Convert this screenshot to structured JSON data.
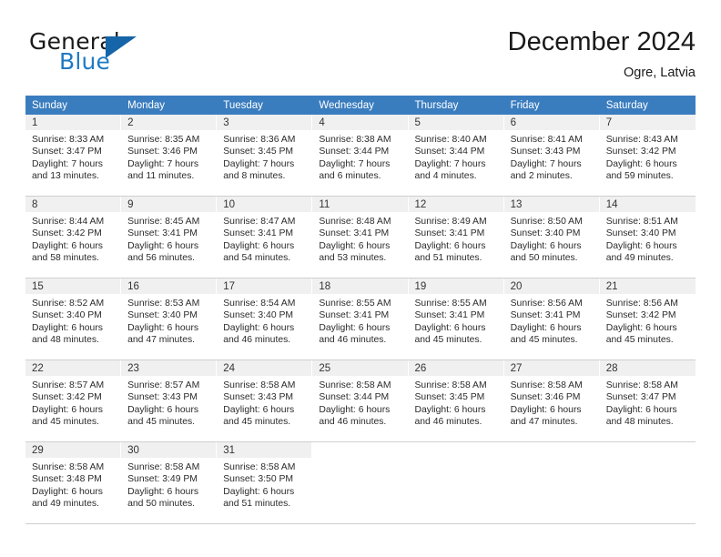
{
  "brand": {
    "name_top": "General",
    "name_bottom": "Blue",
    "triangle_color": "#1565a8",
    "blue_color": "#1f7ac4"
  },
  "header": {
    "title": "December 2024",
    "subtitle": "Ogre, Latvia"
  },
  "theme": {
    "header_bg": "#3a7dbf",
    "header_text": "#ffffff",
    "daynum_bg": "#f0f0f0",
    "grid_line": "#cfcfcf"
  },
  "weekdays": [
    "Sunday",
    "Monday",
    "Tuesday",
    "Wednesday",
    "Thursday",
    "Friday",
    "Saturday"
  ],
  "weeks": [
    [
      {
        "day": "1",
        "sunrise": "Sunrise: 8:33 AM",
        "sunset": "Sunset: 3:47 PM",
        "daylight": "Daylight: 7 hours and 13 minutes."
      },
      {
        "day": "2",
        "sunrise": "Sunrise: 8:35 AM",
        "sunset": "Sunset: 3:46 PM",
        "daylight": "Daylight: 7 hours and 11 minutes."
      },
      {
        "day": "3",
        "sunrise": "Sunrise: 8:36 AM",
        "sunset": "Sunset: 3:45 PM",
        "daylight": "Daylight: 7 hours and 8 minutes."
      },
      {
        "day": "4",
        "sunrise": "Sunrise: 8:38 AM",
        "sunset": "Sunset: 3:44 PM",
        "daylight": "Daylight: 7 hours and 6 minutes."
      },
      {
        "day": "5",
        "sunrise": "Sunrise: 8:40 AM",
        "sunset": "Sunset: 3:44 PM",
        "daylight": "Daylight: 7 hours and 4 minutes."
      },
      {
        "day": "6",
        "sunrise": "Sunrise: 8:41 AM",
        "sunset": "Sunset: 3:43 PM",
        "daylight": "Daylight: 7 hours and 2 minutes."
      },
      {
        "day": "7",
        "sunrise": "Sunrise: 8:43 AM",
        "sunset": "Sunset: 3:42 PM",
        "daylight": "Daylight: 6 hours and 59 minutes."
      }
    ],
    [
      {
        "day": "8",
        "sunrise": "Sunrise: 8:44 AM",
        "sunset": "Sunset: 3:42 PM",
        "daylight": "Daylight: 6 hours and 58 minutes."
      },
      {
        "day": "9",
        "sunrise": "Sunrise: 8:45 AM",
        "sunset": "Sunset: 3:41 PM",
        "daylight": "Daylight: 6 hours and 56 minutes."
      },
      {
        "day": "10",
        "sunrise": "Sunrise: 8:47 AM",
        "sunset": "Sunset: 3:41 PM",
        "daylight": "Daylight: 6 hours and 54 minutes."
      },
      {
        "day": "11",
        "sunrise": "Sunrise: 8:48 AM",
        "sunset": "Sunset: 3:41 PM",
        "daylight": "Daylight: 6 hours and 53 minutes."
      },
      {
        "day": "12",
        "sunrise": "Sunrise: 8:49 AM",
        "sunset": "Sunset: 3:41 PM",
        "daylight": "Daylight: 6 hours and 51 minutes."
      },
      {
        "day": "13",
        "sunrise": "Sunrise: 8:50 AM",
        "sunset": "Sunset: 3:40 PM",
        "daylight": "Daylight: 6 hours and 50 minutes."
      },
      {
        "day": "14",
        "sunrise": "Sunrise: 8:51 AM",
        "sunset": "Sunset: 3:40 PM",
        "daylight": "Daylight: 6 hours and 49 minutes."
      }
    ],
    [
      {
        "day": "15",
        "sunrise": "Sunrise: 8:52 AM",
        "sunset": "Sunset: 3:40 PM",
        "daylight": "Daylight: 6 hours and 48 minutes."
      },
      {
        "day": "16",
        "sunrise": "Sunrise: 8:53 AM",
        "sunset": "Sunset: 3:40 PM",
        "daylight": "Daylight: 6 hours and 47 minutes."
      },
      {
        "day": "17",
        "sunrise": "Sunrise: 8:54 AM",
        "sunset": "Sunset: 3:40 PM",
        "daylight": "Daylight: 6 hours and 46 minutes."
      },
      {
        "day": "18",
        "sunrise": "Sunrise: 8:55 AM",
        "sunset": "Sunset: 3:41 PM",
        "daylight": "Daylight: 6 hours and 46 minutes."
      },
      {
        "day": "19",
        "sunrise": "Sunrise: 8:55 AM",
        "sunset": "Sunset: 3:41 PM",
        "daylight": "Daylight: 6 hours and 45 minutes."
      },
      {
        "day": "20",
        "sunrise": "Sunrise: 8:56 AM",
        "sunset": "Sunset: 3:41 PM",
        "daylight": "Daylight: 6 hours and 45 minutes."
      },
      {
        "day": "21",
        "sunrise": "Sunrise: 8:56 AM",
        "sunset": "Sunset: 3:42 PM",
        "daylight": "Daylight: 6 hours and 45 minutes."
      }
    ],
    [
      {
        "day": "22",
        "sunrise": "Sunrise: 8:57 AM",
        "sunset": "Sunset: 3:42 PM",
        "daylight": "Daylight: 6 hours and 45 minutes."
      },
      {
        "day": "23",
        "sunrise": "Sunrise: 8:57 AM",
        "sunset": "Sunset: 3:43 PM",
        "daylight": "Daylight: 6 hours and 45 minutes."
      },
      {
        "day": "24",
        "sunrise": "Sunrise: 8:58 AM",
        "sunset": "Sunset: 3:43 PM",
        "daylight": "Daylight: 6 hours and 45 minutes."
      },
      {
        "day": "25",
        "sunrise": "Sunrise: 8:58 AM",
        "sunset": "Sunset: 3:44 PM",
        "daylight": "Daylight: 6 hours and 46 minutes."
      },
      {
        "day": "26",
        "sunrise": "Sunrise: 8:58 AM",
        "sunset": "Sunset: 3:45 PM",
        "daylight": "Daylight: 6 hours and 46 minutes."
      },
      {
        "day": "27",
        "sunrise": "Sunrise: 8:58 AM",
        "sunset": "Sunset: 3:46 PM",
        "daylight": "Daylight: 6 hours and 47 minutes."
      },
      {
        "day": "28",
        "sunrise": "Sunrise: 8:58 AM",
        "sunset": "Sunset: 3:47 PM",
        "daylight": "Daylight: 6 hours and 48 minutes."
      }
    ],
    [
      {
        "day": "29",
        "sunrise": "Sunrise: 8:58 AM",
        "sunset": "Sunset: 3:48 PM",
        "daylight": "Daylight: 6 hours and 49 minutes."
      },
      {
        "day": "30",
        "sunrise": "Sunrise: 8:58 AM",
        "sunset": "Sunset: 3:49 PM",
        "daylight": "Daylight: 6 hours and 50 minutes."
      },
      {
        "day": "31",
        "sunrise": "Sunrise: 8:58 AM",
        "sunset": "Sunset: 3:50 PM",
        "daylight": "Daylight: 6 hours and 51 minutes."
      },
      {
        "day": "",
        "sunrise": "",
        "sunset": "",
        "daylight": ""
      },
      {
        "day": "",
        "sunrise": "",
        "sunset": "",
        "daylight": ""
      },
      {
        "day": "",
        "sunrise": "",
        "sunset": "",
        "daylight": ""
      },
      {
        "day": "",
        "sunrise": "",
        "sunset": "",
        "daylight": ""
      }
    ]
  ]
}
